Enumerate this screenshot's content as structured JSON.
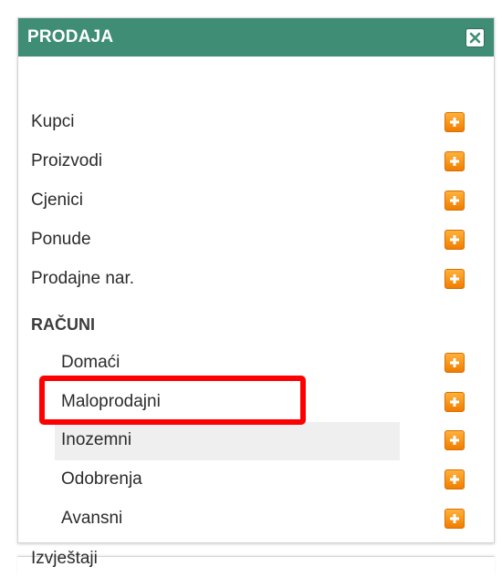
{
  "panel": {
    "title": "PRODAJA",
    "header_color": "#3f8d74",
    "close_icon": "close-x-icon",
    "accent_add_color": "#f28a00"
  },
  "menu": {
    "kupci": "Kupci",
    "proizvodi": "Proizvodi",
    "cjenici": "Cjenici",
    "ponude": "Ponude",
    "prodajne_nar": "Prodajne nar.",
    "racuni_section": "RAČUNI",
    "domaci": "Domaći",
    "maloprodajni": "Maloprodajni",
    "inozemni": "Inozemni",
    "odobrenja": "Odobrenja",
    "avansni": "Avansni",
    "izvjestaji": "Izvještaji"
  },
  "highlight_color": "#ff0000"
}
